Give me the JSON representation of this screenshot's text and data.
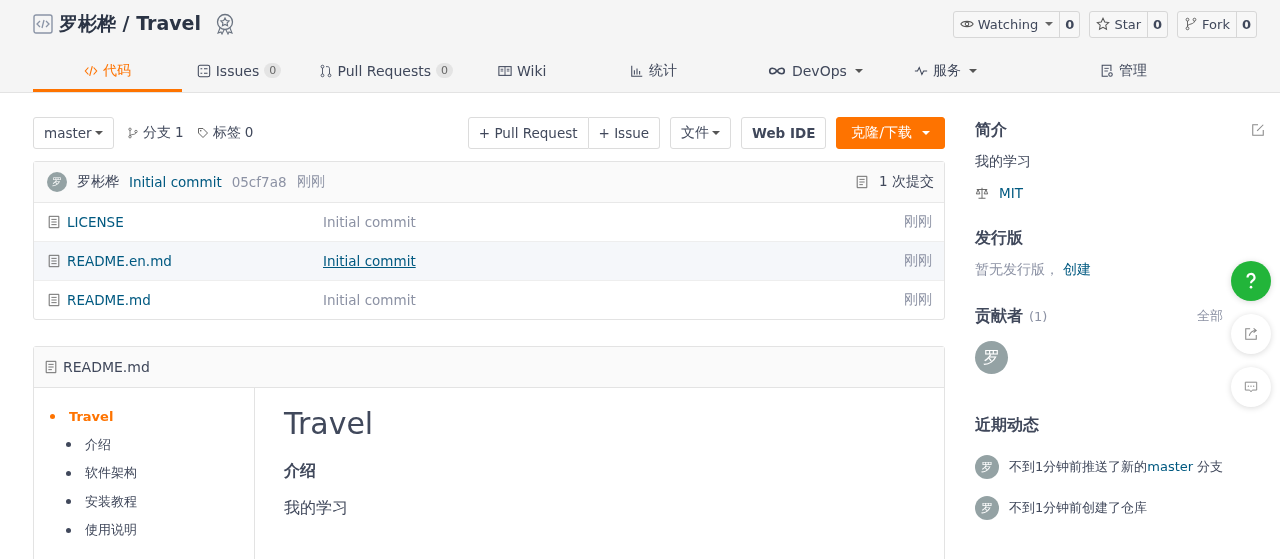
{
  "repo": {
    "owner": "罗彬桦",
    "separator": "/",
    "name": "Travel"
  },
  "actions": [
    {
      "label": "Watching",
      "caret": true,
      "count": "0",
      "kind": "watch"
    },
    {
      "label": "Star",
      "caret": false,
      "count": "0",
      "kind": "star"
    },
    {
      "label": "Fork",
      "caret": false,
      "count": "0",
      "kind": "fork"
    }
  ],
  "tabs": [
    {
      "label": "代码",
      "kind": "code",
      "selected": true
    },
    {
      "label": "Issues",
      "kind": "issues",
      "count": "0",
      "selected": false
    },
    {
      "label": "Pull Requests",
      "kind": "pr",
      "count": "0",
      "selected": false
    },
    {
      "label": "Wiki",
      "kind": "wiki",
      "selected": false
    },
    {
      "label": "统计",
      "kind": "stats",
      "selected": false
    },
    {
      "label": "DevOps",
      "kind": "devops",
      "caret": true,
      "selected": false
    },
    {
      "label": "服务",
      "kind": "service",
      "caret": true,
      "selected": false
    },
    {
      "label": "管理",
      "kind": "manage",
      "selected": false
    }
  ],
  "toolbar": {
    "branch": "master",
    "branches": "分支 1",
    "tags": "标签 0",
    "pull_request": "+ Pull Request",
    "issue": "+ Issue",
    "file": "文件",
    "web_ide": "Web IDE",
    "clone": "克隆/下载"
  },
  "commit": {
    "avatar": "罗",
    "author": "罗彬桦",
    "message": "Initial commit",
    "hash": "05cf7a8",
    "time": "刚刚",
    "count": "1 次提交"
  },
  "files": [
    {
      "name": "LICENSE",
      "message": "Initial commit",
      "time": "刚刚",
      "hovered": false
    },
    {
      "name": "README.en.md",
      "message": "Initial commit",
      "time": "刚刚",
      "hovered": true
    },
    {
      "name": "README.md",
      "message": "Initial commit",
      "time": "刚刚",
      "hovered": false
    }
  ],
  "readme": {
    "title": "README.md",
    "toc": [
      {
        "label": "Travel",
        "selected": true,
        "children": [
          {
            "label": "介绍",
            "selected": false
          },
          {
            "label": "软件架构",
            "selected": false
          },
          {
            "label": "安装教程",
            "selected": false
          },
          {
            "label": "使用说明",
            "selected": false
          }
        ]
      }
    ],
    "heading": "Travel",
    "subheading": "介绍",
    "text": "我的学习"
  },
  "sidebar": {
    "intro_title": "简介",
    "intro": "我的学习",
    "license": "MIT",
    "release_title": "发行版",
    "release_empty": "暂无发行版，",
    "release_create": "创建",
    "contributors_title": "贡献者",
    "contributors_count": "(1)",
    "contributors_all": "全部",
    "contributors": [
      "罗"
    ],
    "activity_title": "近期动态",
    "activity": [
      {
        "avatar": "罗",
        "before": "不到1分钟前推送了新的",
        "link": "master",
        "after": "分支"
      },
      {
        "avatar": "罗",
        "before": "不到1分钟前创建了仓库"
      }
    ]
  }
}
